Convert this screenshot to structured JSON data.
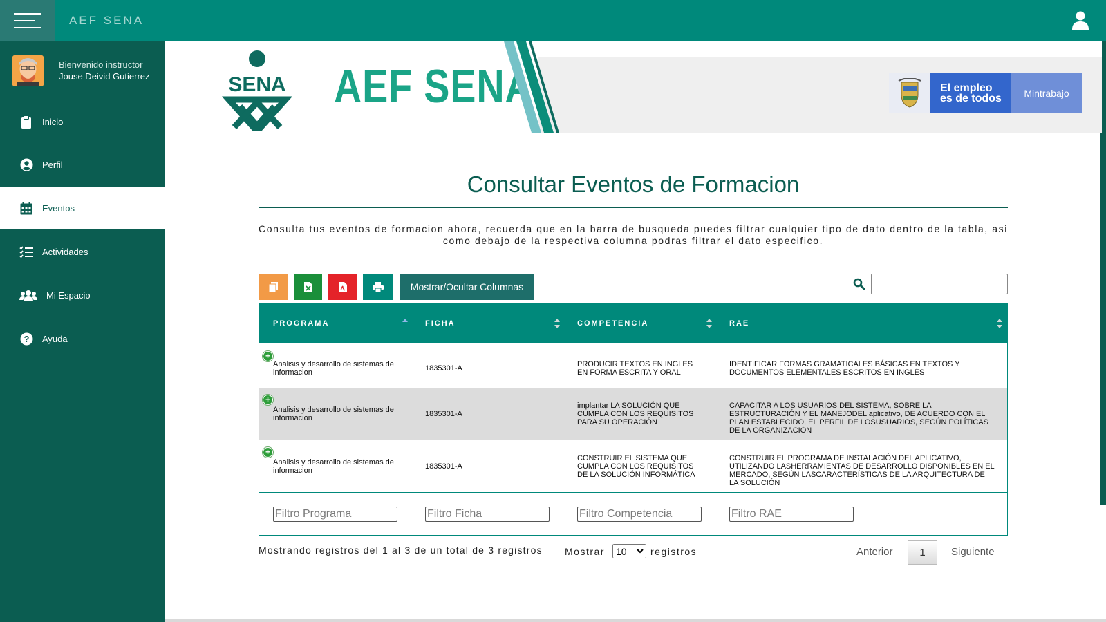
{
  "topbar": {
    "app_title": "AEF SENA"
  },
  "sidebar": {
    "welcome": "Bienvenido instructor",
    "username": "Jouse Deivid Gutierrez",
    "items": [
      {
        "label": "Inicio",
        "icon": "clipboard-icon"
      },
      {
        "label": "Perfil",
        "icon": "user-circle-icon"
      },
      {
        "label": "Eventos",
        "icon": "calendar-icon",
        "active": true
      },
      {
        "label": "Actividades",
        "icon": "tasks-icon"
      },
      {
        "label": "Mi Espacio",
        "icon": "users-icon"
      },
      {
        "label": "Ayuda",
        "icon": "question-circle-icon"
      }
    ]
  },
  "banner": {
    "sena_text": "SENA",
    "logo_text": "AEF SENA",
    "gov_line1": "El empleo",
    "gov_line2": "es de todos",
    "gov_ministry": "Mintrabajo"
  },
  "main": {
    "title": "Consultar Eventos de Formacion",
    "description": "Consulta tus eventos de formacion ahora, recuerda que en la barra de busqueda puedes filtrar cualquier tipo de dato dentro de la tabla, asi como debajo de la respectiva columna podras filtrar el dato especifico.",
    "toolbar": {
      "columns_label": "Mostrar/Ocultar Columnas"
    }
  },
  "table": {
    "headers": [
      "PROGRAMA",
      "FICHA",
      "COMPETENCIA",
      "RAE"
    ],
    "rows": [
      {
        "programa": "Analisis y desarrollo de sistemas de informacion",
        "ficha": "1835301-A",
        "competencia": "PRODUCIR TEXTOS EN INGLES EN FORMA ESCRITA Y ORAL",
        "rae": "IDENTIFICAR FORMAS GRAMATICALES BÁSICAS EN TEXTOS Y DOCUMENTOS ELEMENTALES ESCRITOS EN INGLÉS"
      },
      {
        "programa": "Analisis y desarrollo de sistemas de informacion",
        "ficha": "1835301-A",
        "competencia": "implantar LA SOLUCIÓN QUE CUMPLA CON LOS REQUISITOS PARA SU OPERACIÓN",
        "rae": "CAPACITAR A LOS USUARIOS DEL SISTEMA, SOBRE LA ESTRUCTURACIÓN Y EL MANEJODEL aplicativo, DE ACUERDO CON EL PLAN ESTABLECIDO, EL PERFIL DE LOSUSUARIOS, SEGÚN POLÍTICAS DE LA ORGANIZACIÓN"
      },
      {
        "programa": "Analisis y desarrollo de sistemas de informacion",
        "ficha": "1835301-A",
        "competencia": "CONSTRUIR EL SISTEMA QUE CUMPLA CON LOS REQUISITOS DE LA SOLUCIÓN INFORMÁTICA",
        "rae": "CONSTRUIR EL PROGRAMA DE INSTALACIÓN DEL APLICATIVO, UTILIZANDO LASHERRAMIENTAS DE DESARROLLO DISPONIBLES EN EL MERCADO, SEGÚN LASCARACTERÍSTICAS DE LA ARQUITECTURA DE LA SOLUCIÓN"
      }
    ],
    "filters": {
      "programa": "Filtro Programa",
      "ficha": "Filtro Ficha",
      "competencia": "Filtro Competencia",
      "rae": "Filtro RAE"
    }
  },
  "footer": {
    "info": "Mostrando registros del 1 al 3 de un total de 3 registros",
    "show_label": "Mostrar",
    "page_size": "10",
    "records_label": "registros",
    "prev": "Anterior",
    "page": "1",
    "next": "Siguiente"
  },
  "colors": {
    "primary": "#00897b",
    "sidebar": "#0b5d51",
    "accent_green": "#1aa487"
  }
}
